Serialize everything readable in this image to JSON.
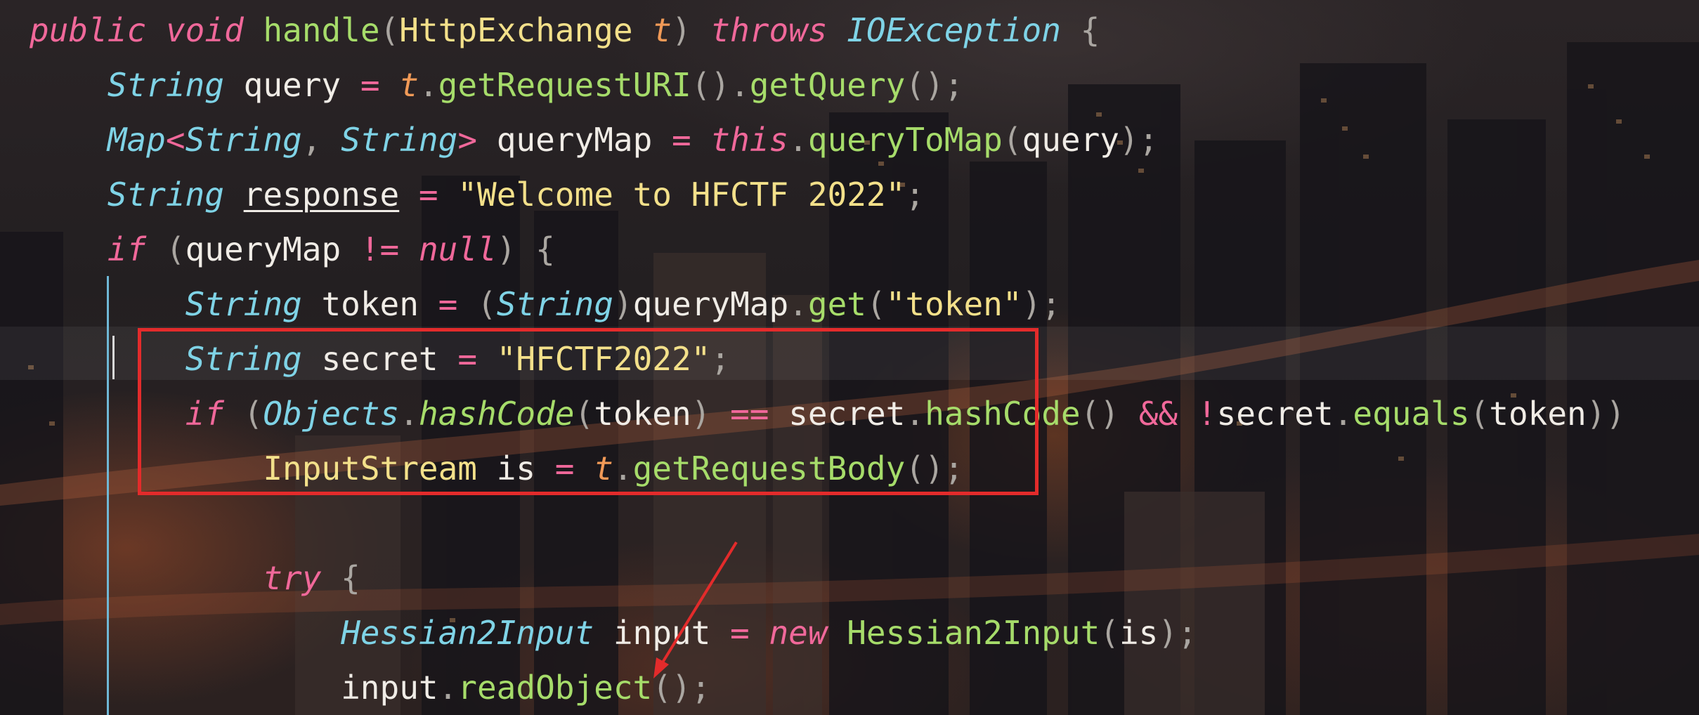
{
  "editor": {
    "theme": {
      "keyword": "#f0689a",
      "type": "#7fd3e6",
      "class": "#f3e08a",
      "method": "#a6dc6a",
      "parameter": "#f19a57",
      "string": "#f3e08a",
      "highlight_box": "#e32b2b",
      "indent_guide": "#6fb8d6"
    },
    "lines": [
      {
        "tokens": [
          {
            "t": "public",
            "c": "kw"
          },
          {
            "t": " ",
            "c": "id"
          },
          {
            "t": "void",
            "c": "kw"
          },
          {
            "t": " ",
            "c": "id"
          },
          {
            "t": "handle",
            "c": "fn"
          },
          {
            "t": "(",
            "c": "pu"
          },
          {
            "t": "HttpExchange",
            "c": "cl"
          },
          {
            "t": " ",
            "c": "id"
          },
          {
            "t": "t",
            "c": "pa"
          },
          {
            "t": ")",
            "c": "pu"
          },
          {
            "t": " ",
            "c": "id"
          },
          {
            "t": "throws",
            "c": "kw"
          },
          {
            "t": " ",
            "c": "id"
          },
          {
            "t": "IOException",
            "c": "ty"
          },
          {
            "t": " ",
            "c": "id"
          },
          {
            "t": "{",
            "c": "pu"
          }
        ]
      },
      {
        "tokens": [
          {
            "t": "    ",
            "c": "id"
          },
          {
            "t": "String",
            "c": "ty"
          },
          {
            "t": " ",
            "c": "id"
          },
          {
            "t": "query",
            "c": "id"
          },
          {
            "t": " ",
            "c": "id"
          },
          {
            "t": "=",
            "c": "op"
          },
          {
            "t": " ",
            "c": "id"
          },
          {
            "t": "t",
            "c": "pa"
          },
          {
            "t": ".",
            "c": "pu"
          },
          {
            "t": "getRequestURI",
            "c": "fn"
          },
          {
            "t": "()",
            "c": "pu"
          },
          {
            "t": ".",
            "c": "pu"
          },
          {
            "t": "getQuery",
            "c": "fn"
          },
          {
            "t": "();",
            "c": "pu"
          }
        ]
      },
      {
        "tokens": [
          {
            "t": "    ",
            "c": "id"
          },
          {
            "t": "Map",
            "c": "ty"
          },
          {
            "t": "<",
            "c": "op"
          },
          {
            "t": "String",
            "c": "ty"
          },
          {
            "t": ", ",
            "c": "pu"
          },
          {
            "t": "String",
            "c": "ty"
          },
          {
            "t": ">",
            "c": "op"
          },
          {
            "t": " ",
            "c": "id"
          },
          {
            "t": "queryMap",
            "c": "id"
          },
          {
            "t": " ",
            "c": "id"
          },
          {
            "t": "=",
            "c": "op"
          },
          {
            "t": " ",
            "c": "id"
          },
          {
            "t": "this",
            "c": "kw"
          },
          {
            "t": ".",
            "c": "pu"
          },
          {
            "t": "queryToMap",
            "c": "fn"
          },
          {
            "t": "(",
            "c": "pu"
          },
          {
            "t": "query",
            "c": "id"
          },
          {
            "t": ");",
            "c": "pu"
          }
        ]
      },
      {
        "tokens": [
          {
            "t": "    ",
            "c": "id"
          },
          {
            "t": "String",
            "c": "ty"
          },
          {
            "t": " ",
            "c": "id"
          },
          {
            "t": "response",
            "c": "id ul"
          },
          {
            "t": " ",
            "c": "id"
          },
          {
            "t": "=",
            "c": "op"
          },
          {
            "t": " ",
            "c": "id"
          },
          {
            "t": "\"Welcome to HFCTF 2022\"",
            "c": "st"
          },
          {
            "t": ";",
            "c": "pu"
          }
        ]
      },
      {
        "tokens": [
          {
            "t": "    ",
            "c": "id"
          },
          {
            "t": "if",
            "c": "kw"
          },
          {
            "t": " ",
            "c": "id"
          },
          {
            "t": "(",
            "c": "pu"
          },
          {
            "t": "queryMap",
            "c": "id"
          },
          {
            "t": " ",
            "c": "id"
          },
          {
            "t": "!=",
            "c": "op"
          },
          {
            "t": " ",
            "c": "id"
          },
          {
            "t": "null",
            "c": "kw"
          },
          {
            "t": ")",
            "c": "pu"
          },
          {
            "t": " ",
            "c": "id"
          },
          {
            "t": "{",
            "c": "pu"
          }
        ]
      },
      {
        "tokens": [
          {
            "t": "        ",
            "c": "id"
          },
          {
            "t": "String",
            "c": "ty"
          },
          {
            "t": " ",
            "c": "id"
          },
          {
            "t": "token",
            "c": "id"
          },
          {
            "t": " ",
            "c": "id"
          },
          {
            "t": "=",
            "c": "op"
          },
          {
            "t": " ",
            "c": "id"
          },
          {
            "t": "(",
            "c": "pu"
          },
          {
            "t": "String",
            "c": "ty"
          },
          {
            "t": ")",
            "c": "pu"
          },
          {
            "t": "queryMap",
            "c": "id"
          },
          {
            "t": ".",
            "c": "pu"
          },
          {
            "t": "get",
            "c": "fn"
          },
          {
            "t": "(",
            "c": "pu"
          },
          {
            "t": "\"token\"",
            "c": "st"
          },
          {
            "t": ");",
            "c": "pu"
          }
        ]
      },
      {
        "tokens": [
          {
            "t": "        ",
            "c": "id"
          },
          {
            "t": "String",
            "c": "ty"
          },
          {
            "t": " ",
            "c": "id"
          },
          {
            "t": "secret",
            "c": "id"
          },
          {
            "t": " ",
            "c": "id"
          },
          {
            "t": "=",
            "c": "op"
          },
          {
            "t": " ",
            "c": "id"
          },
          {
            "t": "\"HFCTF2022\"",
            "c": "st"
          },
          {
            "t": ";",
            "c": "pu"
          }
        ]
      },
      {
        "tokens": [
          {
            "t": "        ",
            "c": "id"
          },
          {
            "t": "if",
            "c": "kw"
          },
          {
            "t": " ",
            "c": "id"
          },
          {
            "t": "(",
            "c": "pu"
          },
          {
            "t": "Objects",
            "c": "ty"
          },
          {
            "t": ".",
            "c": "pu"
          },
          {
            "t": "hashCode",
            "c": "fi"
          },
          {
            "t": "(",
            "c": "pu"
          },
          {
            "t": "token",
            "c": "id"
          },
          {
            "t": ")",
            "c": "pu"
          },
          {
            "t": " ",
            "c": "id"
          },
          {
            "t": "==",
            "c": "op"
          },
          {
            "t": " ",
            "c": "id"
          },
          {
            "t": "secret",
            "c": "id"
          },
          {
            "t": ".",
            "c": "pu"
          },
          {
            "t": "hashCode",
            "c": "fn"
          },
          {
            "t": "()",
            "c": "pu"
          },
          {
            "t": " ",
            "c": "id"
          },
          {
            "t": "&&",
            "c": "op"
          },
          {
            "t": " ",
            "c": "id"
          },
          {
            "t": "!",
            "c": "op"
          },
          {
            "t": "secret",
            "c": "id"
          },
          {
            "t": ".",
            "c": "pu"
          },
          {
            "t": "equals",
            "c": "fn"
          },
          {
            "t": "(",
            "c": "pu"
          },
          {
            "t": "token",
            "c": "id"
          },
          {
            "t": "))",
            "c": "pu"
          }
        ]
      },
      {
        "tokens": [
          {
            "t": "            ",
            "c": "id"
          },
          {
            "t": "InputStream",
            "c": "cl"
          },
          {
            "t": " ",
            "c": "id"
          },
          {
            "t": "is",
            "c": "id"
          },
          {
            "t": " ",
            "c": "id"
          },
          {
            "t": "=",
            "c": "op"
          },
          {
            "t": " ",
            "c": "id"
          },
          {
            "t": "t",
            "c": "pa"
          },
          {
            "t": ".",
            "c": "pu"
          },
          {
            "t": "getRequestBody",
            "c": "fn"
          },
          {
            "t": "();",
            "c": "pu"
          }
        ]
      },
      {
        "tokens": []
      },
      {
        "tokens": [
          {
            "t": "            ",
            "c": "id"
          },
          {
            "t": "try",
            "c": "kw"
          },
          {
            "t": " ",
            "c": "id"
          },
          {
            "t": "{",
            "c": "pu"
          }
        ]
      },
      {
        "tokens": [
          {
            "t": "                ",
            "c": "id"
          },
          {
            "t": "Hessian2Input",
            "c": "ty"
          },
          {
            "t": " ",
            "c": "id"
          },
          {
            "t": "input",
            "c": "id"
          },
          {
            "t": " ",
            "c": "id"
          },
          {
            "t": "=",
            "c": "op"
          },
          {
            "t": " ",
            "c": "id"
          },
          {
            "t": "new",
            "c": "kw"
          },
          {
            "t": " ",
            "c": "id"
          },
          {
            "t": "Hessian2Input",
            "c": "fn"
          },
          {
            "t": "(",
            "c": "pu"
          },
          {
            "t": "is",
            "c": "id"
          },
          {
            "t": ");",
            "c": "pu"
          }
        ]
      },
      {
        "tokens": [
          {
            "t": "                ",
            "c": "id"
          },
          {
            "t": "input",
            "c": "id"
          },
          {
            "t": ".",
            "c": "pu"
          },
          {
            "t": "readObject",
            "c": "fn"
          },
          {
            "t": "();",
            "c": "pu"
          }
        ]
      }
    ]
  }
}
